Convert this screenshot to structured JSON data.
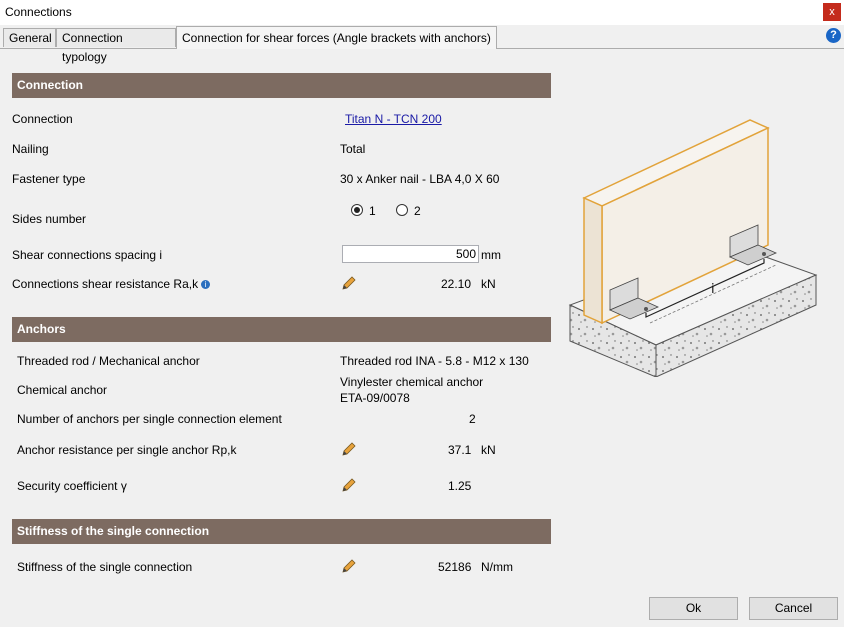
{
  "window": {
    "title": "Connections",
    "close_glyph": "x"
  },
  "tabs": [
    {
      "label": "General"
    },
    {
      "label": "Connection typology"
    },
    {
      "label": "Connection for shear forces (Angle brackets with anchors)"
    }
  ],
  "help": {
    "glyph": "?"
  },
  "connection": {
    "header": "Connection",
    "connection_label": "Connection",
    "connection_value": "Titan N - TCN 200",
    "nailing_label": "Nailing",
    "nailing_value": "Total",
    "fastener_label": "Fastener type",
    "fastener_value": "30  x  Anker nail - LBA 4,0 X 60",
    "sides_label": "Sides number",
    "sides_options": [
      "1",
      "2"
    ],
    "sides_selected": "1",
    "spacing_label": "Shear connections spacing i",
    "spacing_value": "500",
    "spacing_unit": "mm",
    "resistance_label": "Connections shear resistance Ra,k",
    "resistance_value": "22.10",
    "resistance_unit": "kN"
  },
  "anchors": {
    "header": "Anchors",
    "threaded_label": "Threaded rod / Mechanical anchor",
    "threaded_value": "Threaded rod INA - 5.8 - M12 x 130",
    "chemical_label": "Chemical anchor",
    "chemical_value_1": "Vinylester chemical anchor",
    "chemical_value_2": "ETA-09/0078",
    "count_label": "Number of anchors per single connection element",
    "count_value": "2",
    "anchor_res_label": "Anchor resistance per single anchor Rp,k",
    "anchor_res_value": "37.1",
    "anchor_res_unit": "kN",
    "security_label": "Security coefficient γ",
    "security_value": "1.25"
  },
  "stiffness": {
    "header": "Stiffness of the single connection",
    "label": "Stiffness of the single connection",
    "value": "52186",
    "unit": "N/mm"
  },
  "buttons": {
    "ok": "Ok",
    "cancel": "Cancel"
  },
  "illustration": {
    "dimension_label": "i"
  },
  "colors": {
    "section_header": "#7d6b61",
    "wall_outline": "#e2a33a",
    "link": "#1a1aa6"
  }
}
